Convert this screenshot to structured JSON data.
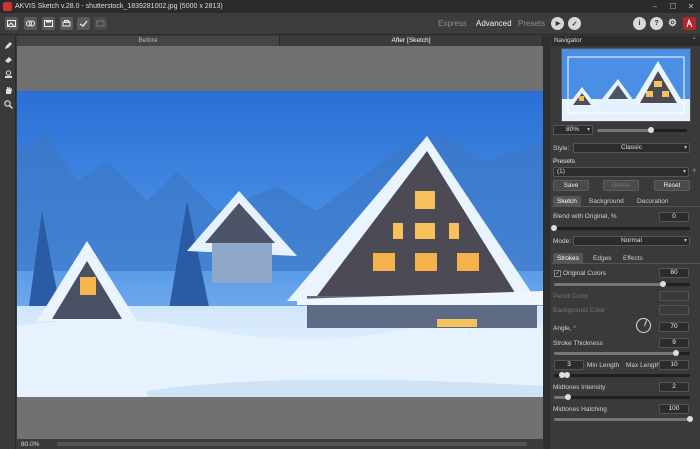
{
  "window": {
    "title": "AKVIS Sketch v.28.0 - shutterstock_1839281002.jpg (5000 x 2813)",
    "minimize_glyph": "–",
    "maximize_glyph": "☐",
    "close_glyph": "✕"
  },
  "toolbar": {
    "modes": [
      {
        "label": "Express",
        "active": false
      },
      {
        "label": "Advanced",
        "active": true
      },
      {
        "label": "Presets",
        "active": false
      }
    ],
    "run_glyph": "▶",
    "apply_glyph": "✓",
    "info_glyph": "i",
    "help_glyph": "?",
    "settings_glyph": "⚙"
  },
  "view_tabs": [
    {
      "label": "Before",
      "active": false
    },
    {
      "label": "After [Sketch]",
      "active": true
    }
  ],
  "status": {
    "zoom": "80.0%"
  },
  "navigator": {
    "title": "Navigator",
    "zoom": "80%",
    "zoom_slider": 0.6
  },
  "style": {
    "label": "Style:",
    "value": "Classic"
  },
  "presets": {
    "label": "Presets",
    "value": "(1)",
    "save": "Save",
    "delete": "Delete",
    "reset": "Reset"
  },
  "main_tabs": [
    {
      "label": "Sketch",
      "active": true
    },
    {
      "label": "Background",
      "active": false
    },
    {
      "label": "Decoration",
      "active": false
    }
  ],
  "blend": {
    "label": "Blend with Original, %",
    "value": "0",
    "fraction": 0.0
  },
  "mode": {
    "label": "Mode:",
    "value": "Normal"
  },
  "sub_tabs": [
    {
      "label": "Strokes",
      "active": true
    },
    {
      "label": "Edges",
      "active": false
    },
    {
      "label": "Effects",
      "active": false
    }
  ],
  "original_colors": {
    "label": "Original Colors",
    "value": "80",
    "fraction": 0.8,
    "checked_glyph": "✓"
  },
  "pencil_color": {
    "label": "Pencil Color"
  },
  "background_color": {
    "label": "Background Color"
  },
  "angle": {
    "label": "Angle, °",
    "value": "70"
  },
  "stroke_thickness": {
    "label": "Stroke Thickness",
    "value": "9",
    "fraction": 0.9
  },
  "stroke_length": {
    "min_value": "3",
    "min_label": "Min Length",
    "max_label": "Max Length",
    "max_value": "10"
  },
  "midtones_intensity": {
    "label": "Midtones Intensity",
    "value": "2",
    "fraction": 0.1
  },
  "midtones_hatching": {
    "label": "Midtones Hatching",
    "value": "100",
    "fraction": 1.0
  }
}
